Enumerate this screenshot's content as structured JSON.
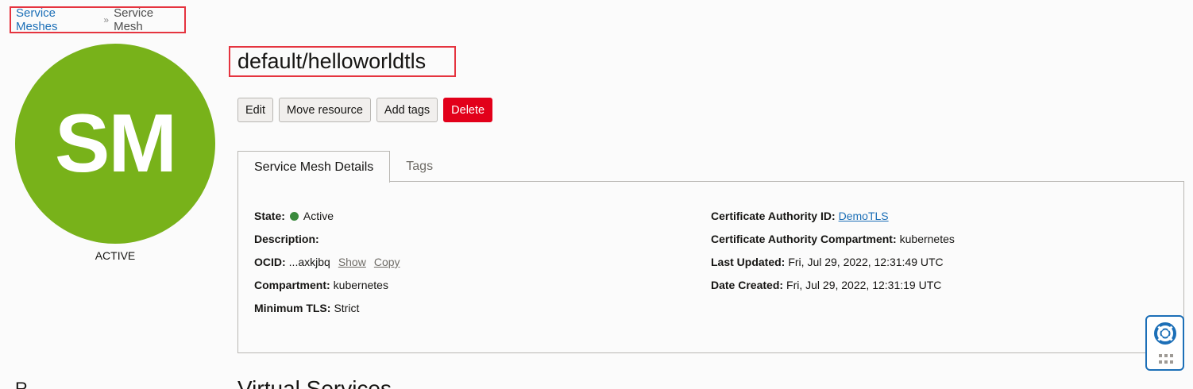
{
  "breadcrumb": {
    "parent": "Service Meshes",
    "separator": "»",
    "current": "Service Mesh"
  },
  "avatar": {
    "initials": "SM",
    "status": "ACTIVE",
    "color": "#78b21a"
  },
  "title": "default/helloworldtls",
  "actions": {
    "edit": "Edit",
    "move": "Move resource",
    "add_tags": "Add tags",
    "delete": "Delete"
  },
  "tabs": [
    {
      "label": "Service Mesh Details",
      "active": true
    },
    {
      "label": "Tags",
      "active": false
    }
  ],
  "details": {
    "state_label": "State:",
    "state_value": "Active",
    "state_color": "#3a8a3d",
    "description_label": "Description:",
    "description_value": "",
    "ocid_label": "OCID:",
    "ocid_value": "...axkjbq",
    "ocid_show": "Show",
    "ocid_copy": "Copy",
    "compartment_label": "Compartment:",
    "compartment_value": "kubernetes",
    "min_tls_label": "Minimum TLS:",
    "min_tls_value": "Strict",
    "ca_id_label": "Certificate Authority ID:",
    "ca_id_value": "DemoTLS",
    "ca_compartment_label": "Certificate Authority Compartment:",
    "ca_compartment_value": "kubernetes",
    "last_updated_label": "Last Updated:",
    "last_updated_value": "Fri, Jul 29, 2022, 12:31:49 UTC",
    "date_created_label": "Date Created:",
    "date_created_value": "Fri, Jul 29, 2022, 12:31:19 UTC"
  },
  "sections": {
    "left_heading": "R",
    "main_heading": "Virtual Services"
  },
  "help_widget": {
    "icon": "lifebuoy-icon",
    "grip_icon": "drag-grip-icon"
  }
}
